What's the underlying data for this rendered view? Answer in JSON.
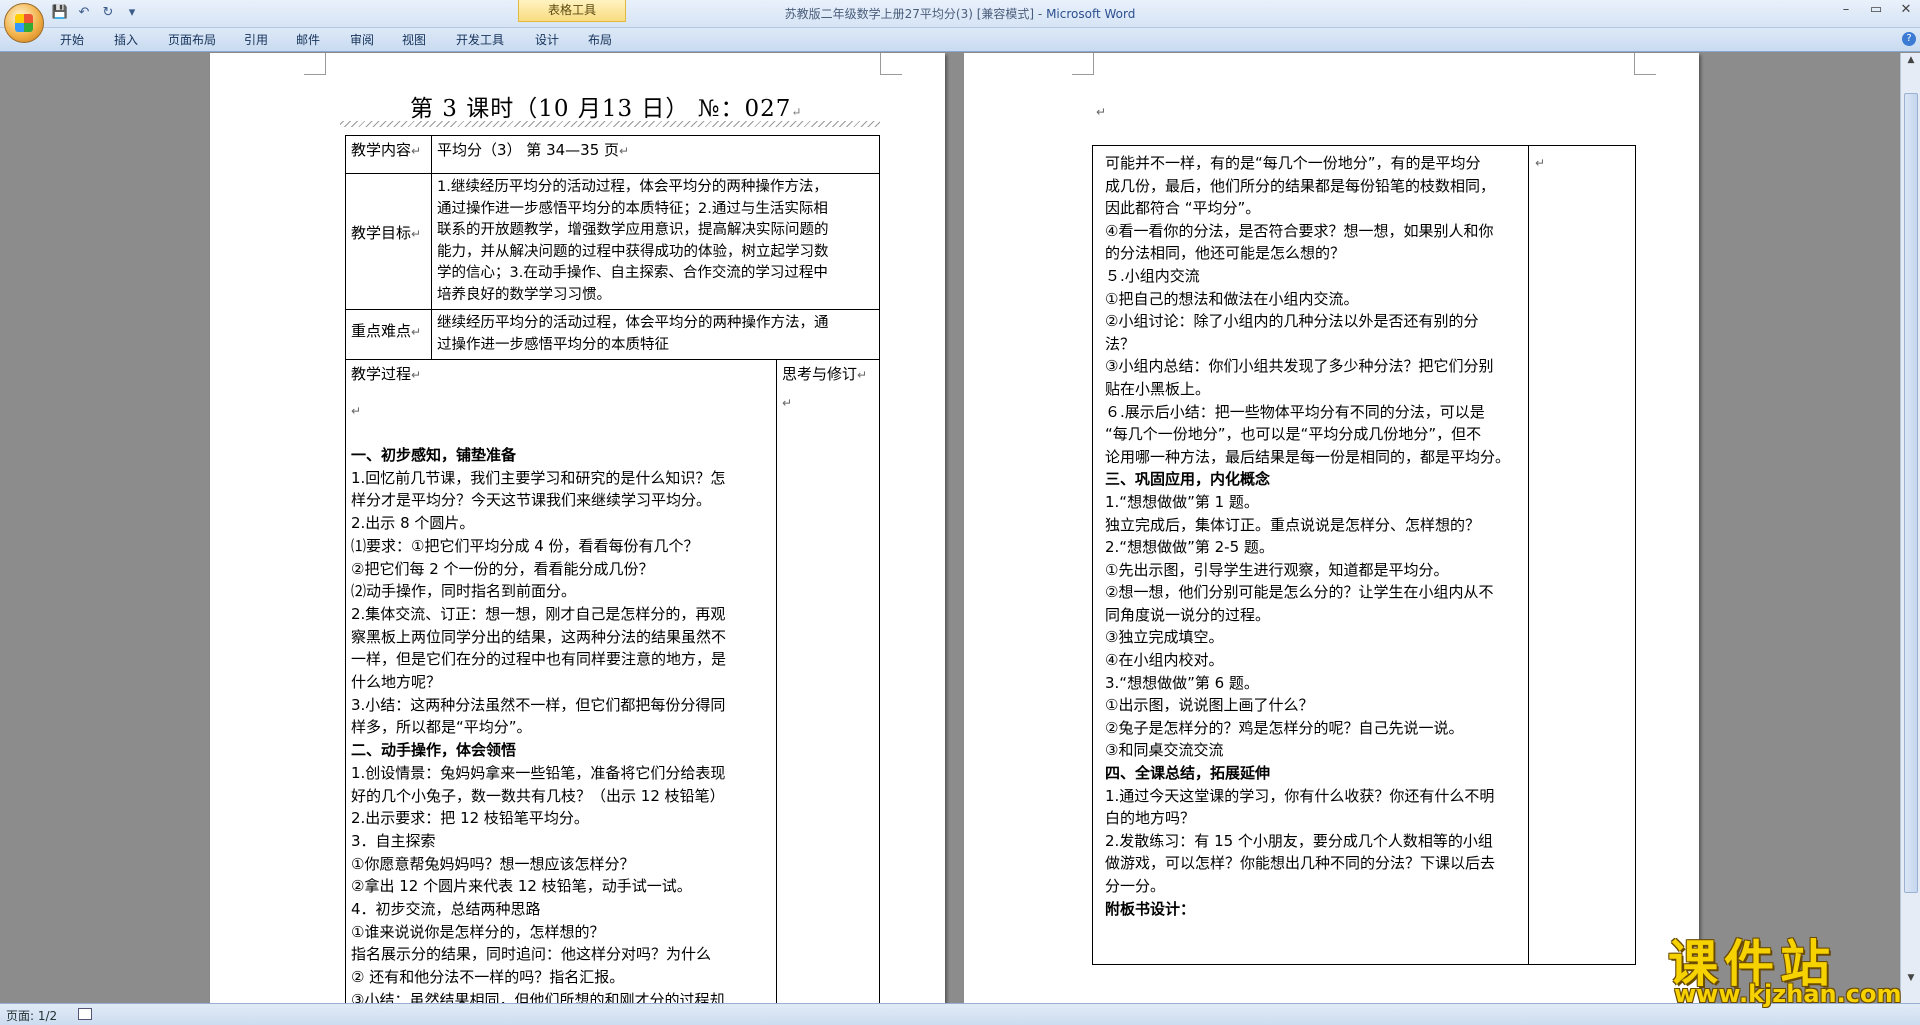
{
  "window": {
    "title_doc": "苏教版二年级数学上册27平均分(3) [兼容模式] - ",
    "title_app": "Microsoft Word",
    "context_tab_group": "表格工具"
  },
  "quick_access": {
    "save": "💾",
    "undo": "↶",
    "redo": "↻",
    "customize": "▾"
  },
  "ribbon": {
    "tabs": [
      "开始",
      "插入",
      "页面布局",
      "引用",
      "邮件",
      "审阅",
      "视图",
      "开发工具",
      "设计",
      "布局"
    ]
  },
  "page1": {
    "title": "第  3  课时（10  月13 日）  №：027",
    "table": {
      "content_label": "教学内容",
      "content_value": "平均分（3） 第 34—35 页",
      "goal_label": "教学目标",
      "goal_lines": [
        "1.继续经历平均分的活动过程，体会平均分的两种操作方法，",
        "通过操作进一步感悟平均分的本质特征；2.通过与生活实际相",
        "联系的开放题教学，增强数学应用意识，提高解决实际问题的",
        "能力，并从解决问题的过程中获得成功的体验，树立起学习数",
        "学的信心；3.在动手操作、自主探索、合作交流的学习过程中",
        "培养良好的数学学习习惯。"
      ],
      "key_label": "重点难点",
      "key_lines": [
        "继续经历平均分的活动过程，体会平均分的两种操作方法，通",
        "过操作进一步感悟平均分的本质特征"
      ],
      "process_label": "教学过程",
      "revise_label": "思考与修订"
    },
    "process_lines": [
      {
        "t": "一、初步感知，铺垫准备",
        "b": true
      },
      {
        "t": "1.回忆前几节课，我们主要学习和研究的是什么知识？怎"
      },
      {
        "t": "样分才是平均分？今天这节课我们来继续学习平均分。"
      },
      {
        "t": "2.出示 8 个圆片。"
      },
      {
        "t": "⑴要求：①把它们平均分成 4 份，看看每份有几个？"
      },
      {
        "t": "           ②把它们每 2 个一份的分，看看能分成几份？"
      },
      {
        "t": "⑵动手操作，同时指名到前面分。"
      },
      {
        "t": "2.集体交流、订正：想一想，刚才自己是怎样分的，再观"
      },
      {
        "t": "察黑板上两位同学分出的结果，这两种分法的结果虽然不"
      },
      {
        "t": "一样，但是它们在分的过程中也有同样要注意的地方，是"
      },
      {
        "t": "什么地方呢？"
      },
      {
        "t": "3.小结：这两种分法虽然不一样，但它们都把每份分得同"
      },
      {
        "t": "样多，所以都是“平均分”。"
      },
      {
        "t": "二、动手操作，体会领悟",
        "b": true
      },
      {
        "t": "1.创设情景：兔妈妈拿来一些铅笔，准备将它们分给表现"
      },
      {
        "t": "好的几个小兔子，数一数共有几枝？（出示 12 枝铅笔）"
      },
      {
        "t": "2.出示要求：把 12 枝铅笔平均分。"
      },
      {
        "t": "3．自主探索"
      },
      {
        "t": "①你愿意帮兔妈妈吗？想一想应该怎样分？"
      },
      {
        "t": "②拿出 12 个圆片来代表 12 枝铅笔，动手试一试。"
      },
      {
        "t": "4．初步交流，总结两种思路"
      },
      {
        "t": "①谁来说说你是怎样分的，怎样想的？"
      },
      {
        "t": "指名展示分的结果，同时追问：他这样分对吗？为什么"
      },
      {
        "t": "②   还有和他分法不一样的吗？指名汇报。"
      },
      {
        "t": "③小结：虽然结果相同，但他们所想的和刚才分的过程却"
      }
    ]
  },
  "page2": {
    "lines": [
      {
        "t": "可能并不一样，有的是“每几个一份地分”，有的是平均分"
      },
      {
        "t": "成几份，最后，他们所分的结果都是每份铅笔的枝数相同，"
      },
      {
        "t": "因此都符合 “平均分”。"
      },
      {
        "t": "④看一看你的分法，是否符合要求？想一想，如果别人和你"
      },
      {
        "t": "的分法相同，他还可能是怎么想的？"
      },
      {
        "t": "５.小组内交流"
      },
      {
        "t": "①把自己的想法和做法在小组内交流。"
      },
      {
        "t": "②小组讨论：除了小组内的几种分法以外是否还有别的分"
      },
      {
        "t": "法？"
      },
      {
        "t": "③小组内总结：你们小组共发现了多少种分法？把它们分别"
      },
      {
        "t": "贴在小黑板上。"
      },
      {
        "t": "６.展示后小结：把一些物体平均分有不同的分法，可以是"
      },
      {
        "t": "“每几个一份地分”，也可以是“平均分成几份地分”，但不"
      },
      {
        "t": "论用哪一种方法，最后结果是每一份是相同的，都是平均分。"
      },
      {
        "t": "三、巩固应用，内化概念",
        "b": true
      },
      {
        "t": "1.“想想做做”第 1 题。"
      },
      {
        "t": "独立完成后，集体订正。重点说说是怎样分、怎样想的？"
      },
      {
        "t": "2.“想想做做”第 2-5 题。"
      },
      {
        "t": "①先出示图，引导学生进行观察，知道都是平均分。"
      },
      {
        "t": "②想一想，他们分别可能是怎么分的？让学生在小组内从不"
      },
      {
        "t": "同角度说一说分的过程。"
      },
      {
        "t": "③独立完成填空。"
      },
      {
        "t": "④在小组内校对。"
      },
      {
        "t": "3.“想想做做”第 6 题。"
      },
      {
        "t": "①出示图，说说图上画了什么？"
      },
      {
        "t": "②兔子是怎样分的？鸡是怎样分的呢？自己先说一说。"
      },
      {
        "t": "③和同桌交流交流"
      },
      {
        "t": "四、全课总结，拓展延伸",
        "b": true
      },
      {
        "t": "1.通过今天这堂课的学习，你有什么收获？你还有什么不明"
      },
      {
        "t": "白的地方吗？"
      },
      {
        "t": "2.发散练习：有 15 个小朋友，要分成几个人数相等的小组"
      },
      {
        "t": "做游戏，可以怎样？你能想出几种不同的分法？下课以后去"
      },
      {
        "t": "分一分。"
      },
      {
        "t": "附板书设计：",
        "b": true
      }
    ]
  },
  "status": {
    "page": "页面: 1/2"
  },
  "watermark": {
    "cn": "课件站",
    "url": "www.kjzhan.com"
  }
}
